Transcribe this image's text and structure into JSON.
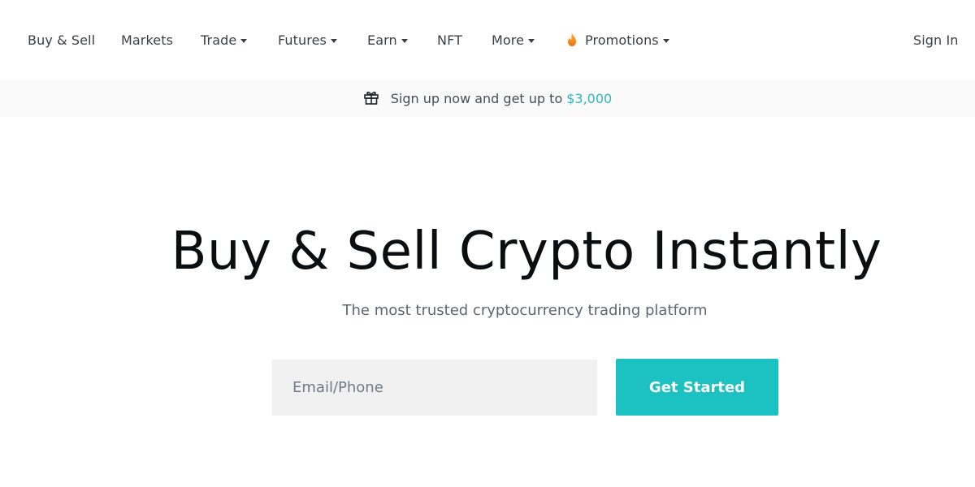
{
  "nav": {
    "items": [
      {
        "label": "Buy & Sell",
        "has_dropdown": false
      },
      {
        "label": "Markets",
        "has_dropdown": false
      },
      {
        "label": "Trade",
        "has_dropdown": true
      },
      {
        "label": "Futures",
        "has_dropdown": true
      },
      {
        "label": "Earn",
        "has_dropdown": true
      },
      {
        "label": "NFT",
        "has_dropdown": false
      },
      {
        "label": "More",
        "has_dropdown": true
      },
      {
        "label": "Promotions",
        "has_dropdown": true,
        "icon": "flame-icon"
      }
    ],
    "sign_in": "Sign In"
  },
  "banner": {
    "icon": "gift-icon",
    "text": "Sign up now and get up to",
    "amount": "$3,000",
    "amount_color": "#2fb5be"
  },
  "hero": {
    "title": "Buy & Sell Crypto Instantly",
    "subtitle": "The most trusted cryptocurrency trading platform",
    "email_placeholder": "Email/Phone",
    "email_value": "",
    "cta_label": "Get Started",
    "cta_color": "#1cc2c2"
  }
}
